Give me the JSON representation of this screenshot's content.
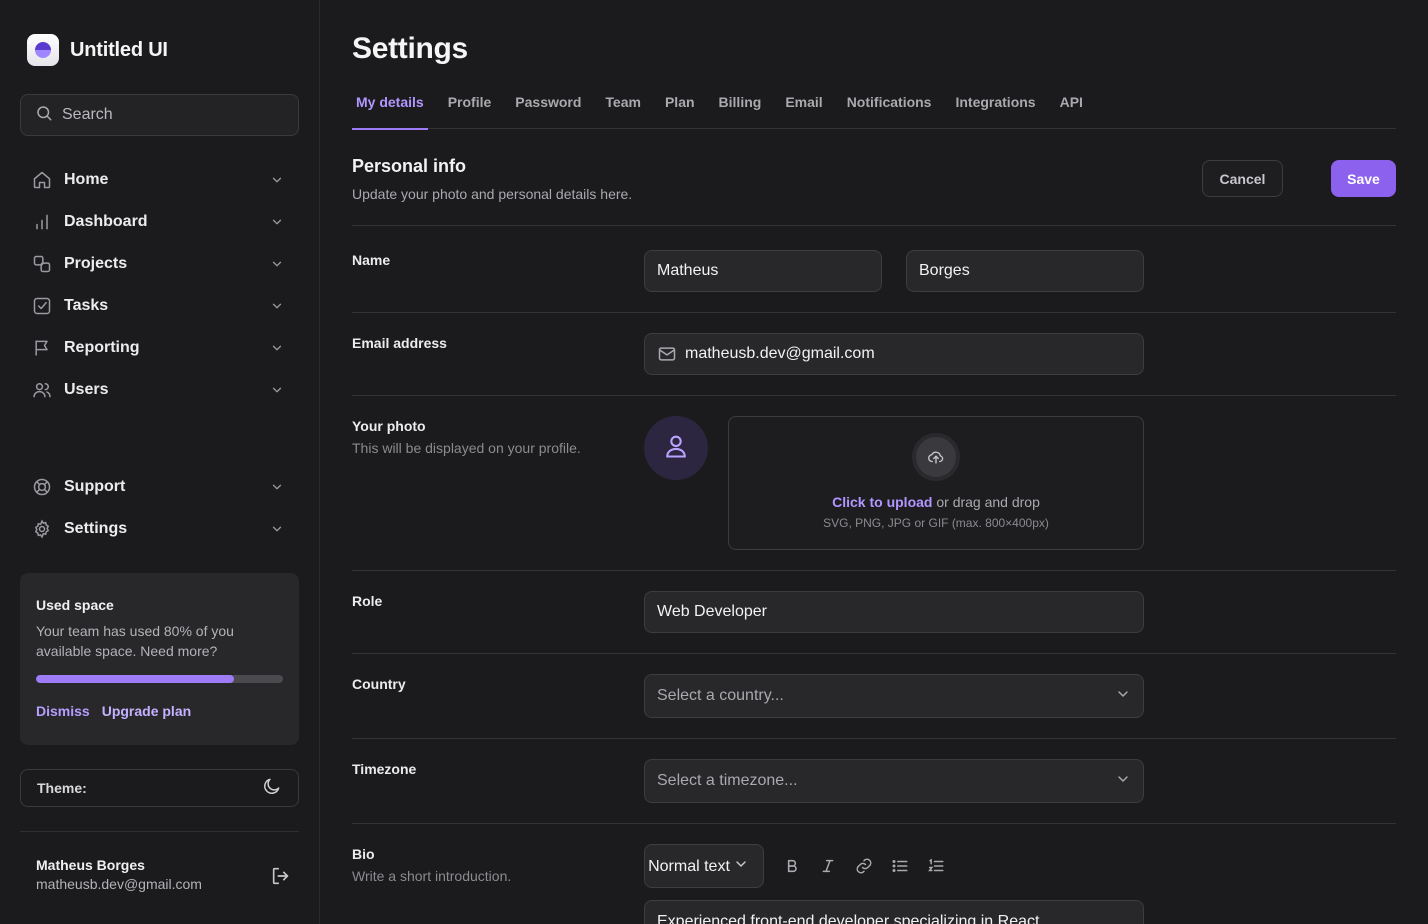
{
  "sidebar": {
    "brand": "Untitled UI",
    "search_placeholder": "Search",
    "nav_items": [
      {
        "label": "Home",
        "icon": "home-icon"
      },
      {
        "label": "Dashboard",
        "icon": "bar-chart-icon"
      },
      {
        "label": "Projects",
        "icon": "layers-icon"
      },
      {
        "label": "Tasks",
        "icon": "check-square-icon"
      },
      {
        "label": "Reporting",
        "icon": "flag-icon"
      },
      {
        "label": "Users",
        "icon": "users-icon"
      }
    ],
    "footer_items": [
      {
        "label": "Support",
        "icon": "life-buoy-icon"
      },
      {
        "label": "Settings",
        "icon": "gear-icon"
      }
    ],
    "usage": {
      "title": "Used space",
      "text": "Your team has used 80% of you available space. Need more?",
      "percent": 80,
      "dismiss": "Dismiss",
      "upgrade": "Upgrade plan"
    },
    "theme_label": "Theme:",
    "account": {
      "name": "Matheus Borges",
      "email": "matheusb.dev@gmail.com"
    }
  },
  "main": {
    "title": "Settings",
    "tabs": [
      {
        "label": "My details",
        "active": true
      },
      {
        "label": "Profile"
      },
      {
        "label": "Password"
      },
      {
        "label": "Team"
      },
      {
        "label": "Plan"
      },
      {
        "label": "Billing"
      },
      {
        "label": "Email"
      },
      {
        "label": "Notifications"
      },
      {
        "label": "Integrations"
      },
      {
        "label": "API"
      }
    ],
    "section": {
      "title": "Personal info",
      "subtitle": "Update your photo and personal details here.",
      "cancel": "Cancel",
      "save": "Save"
    },
    "form": {
      "name_label": "Name",
      "first_name": "Matheus",
      "last_name": "Borges",
      "email_label": "Email address",
      "email": "matheusb.dev@gmail.com",
      "photo_label": "Your photo",
      "photo_hint": "This will be displayed on your profile.",
      "upload_click": "Click to upload",
      "upload_rest": " or drag and drop",
      "upload_hint": "SVG, PNG, JPG or GIF (max. 800×400px)",
      "role_label": "Role",
      "role": "Web Developer",
      "country_label": "Country",
      "country_placeholder": "Select a country...",
      "timezone_label": "Timezone",
      "timezone_placeholder": "Select a timezone...",
      "bio_label": "Bio",
      "bio_hint": "Write a short introduction.",
      "text_style": "Normal text",
      "bio_text": "Experienced front-end developer specializing in React"
    }
  },
  "colors": {
    "accent": "#9e7cf7",
    "background": "#1b1b1d",
    "surface": "#28282b"
  }
}
